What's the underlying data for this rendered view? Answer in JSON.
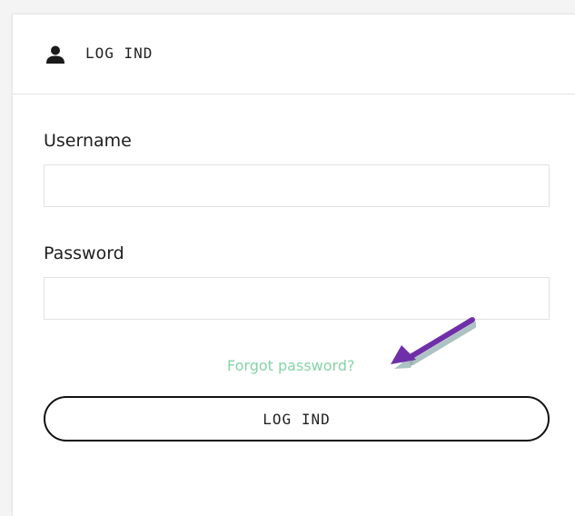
{
  "header": {
    "icon": "user-icon",
    "title": "LOG IND"
  },
  "form": {
    "username_label": "Username",
    "username_value": "",
    "password_label": "Password",
    "password_value": "",
    "forgot_link": "Forgot password?",
    "submit_label": "LOG IND"
  },
  "annotation": {
    "icon": "arrow-annotation-icon",
    "color": "#6f2fa8"
  },
  "colors": {
    "link": "#86d3a6",
    "button_border": "#111111",
    "text": "#1e1e1e"
  }
}
